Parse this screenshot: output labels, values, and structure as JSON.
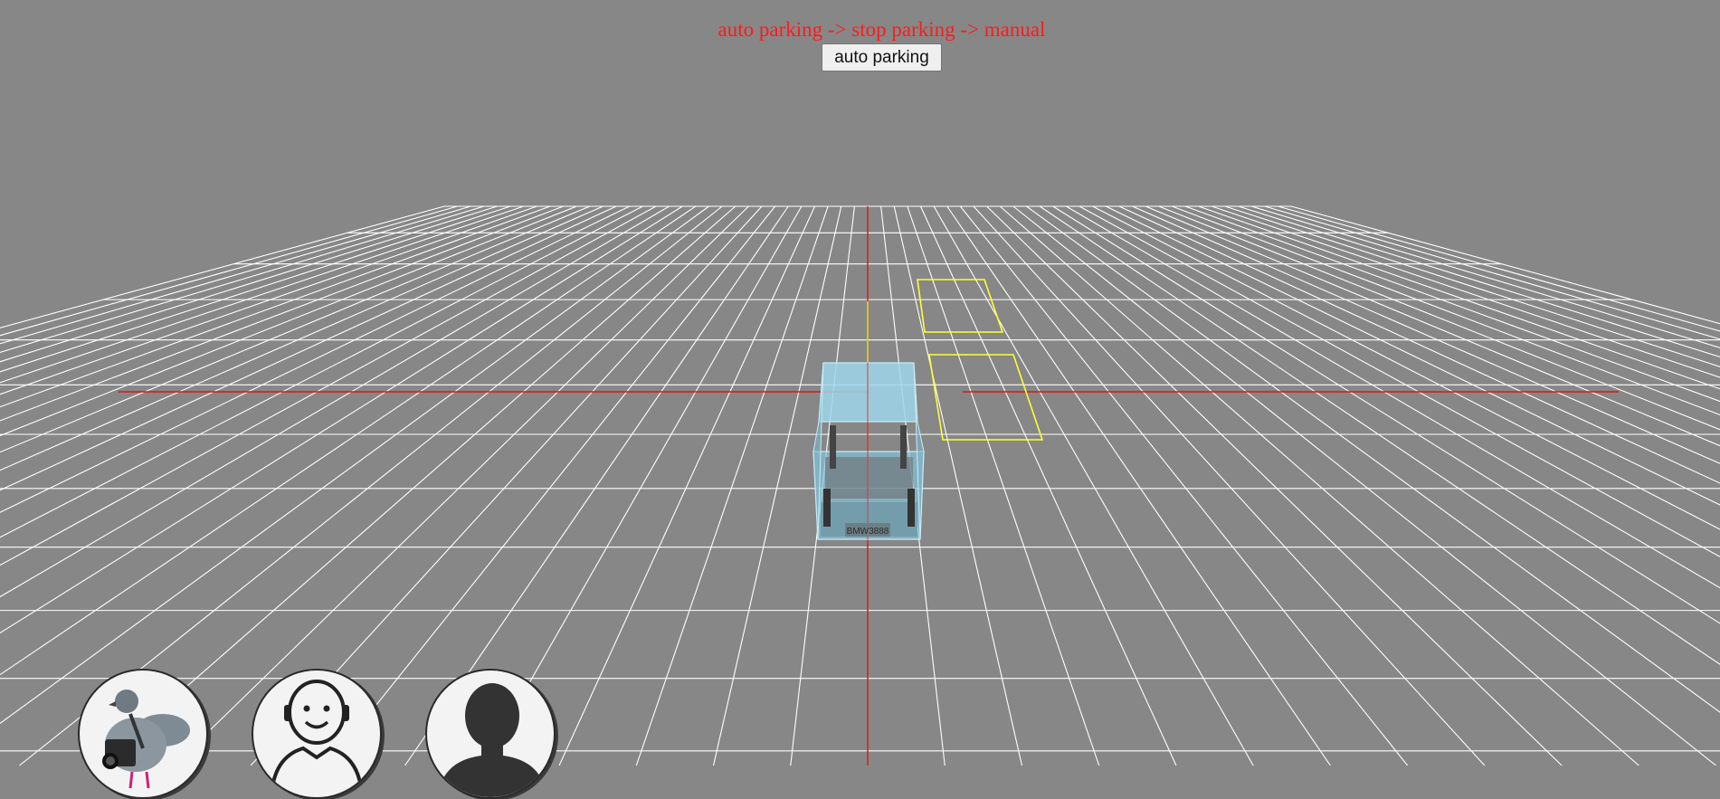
{
  "header": {
    "mode_sequence": "auto parking -> stop parking -> manual",
    "mode_button_label": "auto parking"
  },
  "scene": {
    "background_color": "#878787",
    "grid_color": "#ffffff",
    "axis_color": "#d41a1a",
    "parking_slot_color": "#ffff33",
    "vehicle_color": "#8fd3ea",
    "license_plate_text": "BMW3888"
  },
  "view_buttons": [
    {
      "name": "bird-view",
      "icon": "pigeon-camera-icon"
    },
    {
      "name": "driver-view",
      "icon": "smiling-driver-icon"
    },
    {
      "name": "person-view",
      "icon": "person-silhouette-icon"
    }
  ]
}
